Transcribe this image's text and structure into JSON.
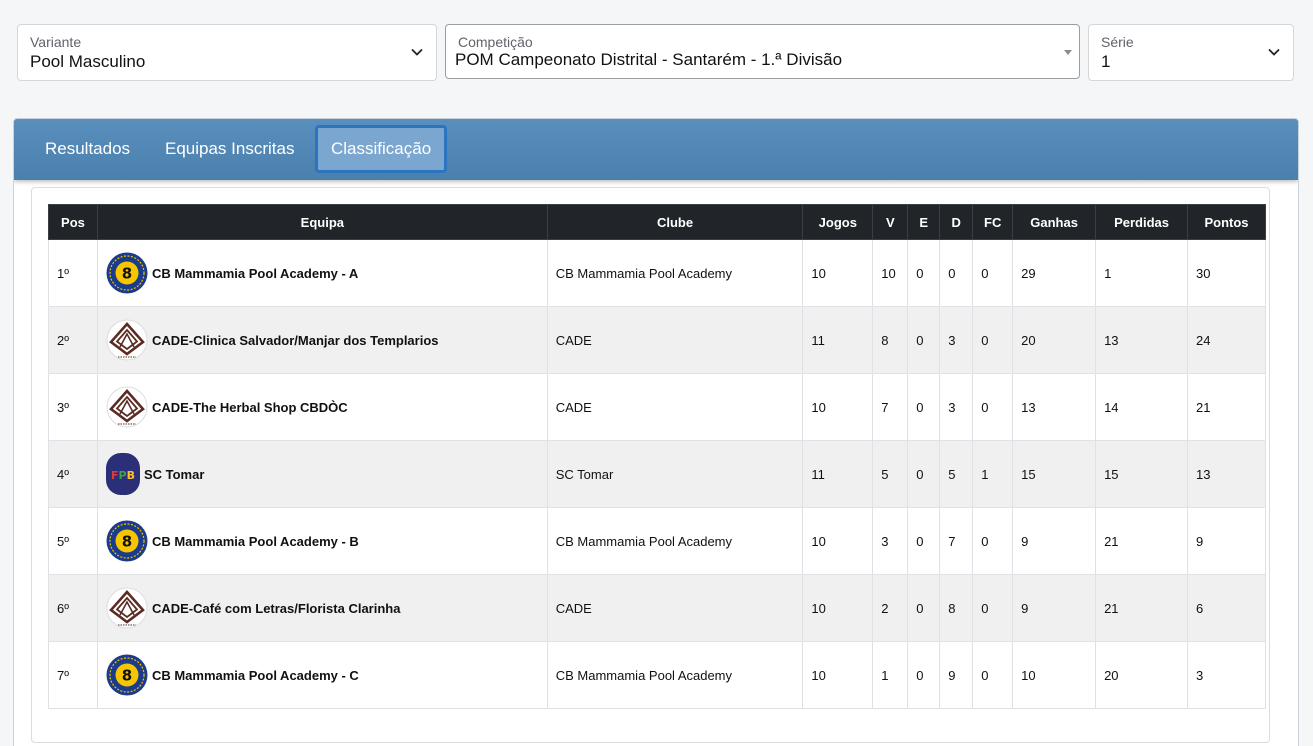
{
  "filters": {
    "variant": {
      "label": "Variante",
      "value": "Pool Masculino"
    },
    "competition": {
      "label": "Competição",
      "value": "POM Campeonato Distrital - Santarém - 1.ª Divisão"
    },
    "serie": {
      "label": "Série",
      "value": "1"
    }
  },
  "tabs": [
    "Resultados",
    "Equipas Inscritas",
    "Classificação"
  ],
  "active_tab": "Classificação",
  "table": {
    "headers": [
      "Pos",
      "Equipa",
      "Clube",
      "Jogos",
      "V",
      "E",
      "D",
      "FC",
      "Ganhas",
      "Perdidas",
      "Pontos"
    ],
    "rows": [
      {
        "pos": "1º",
        "team": "CB Mammamia Pool Academy - A",
        "logo": "mammamia-8-ball-logo",
        "club": "CB Mammamia Pool Academy",
        "jogos": "10",
        "v": "10",
        "e": "0",
        "d": "0",
        "fc": "0",
        "ganhas": "29",
        "perdidas": "1",
        "pontos": "30"
      },
      {
        "pos": "2º",
        "team": "CADE-Clinica Salvador/Manjar dos Templarios",
        "logo": "cade-logo",
        "club": "CADE",
        "jogos": "11",
        "v": "8",
        "e": "0",
        "d": "3",
        "fc": "0",
        "ganhas": "20",
        "perdidas": "13",
        "pontos": "24"
      },
      {
        "pos": "3º",
        "team": "CADE-The Herbal Shop CBDÒC",
        "logo": "cade-logo",
        "club": "CADE",
        "jogos": "10",
        "v": "7",
        "e": "0",
        "d": "3",
        "fc": "0",
        "ganhas": "13",
        "perdidas": "14",
        "pontos": "21"
      },
      {
        "pos": "4º",
        "team": "SC Tomar",
        "logo": "fpb-logo",
        "club": "SC Tomar",
        "jogos": "11",
        "v": "5",
        "e": "0",
        "d": "5",
        "fc": "1",
        "ganhas": "15",
        "perdidas": "15",
        "pontos": "13"
      },
      {
        "pos": "5º",
        "team": "CB Mammamia Pool Academy - B",
        "logo": "mammamia-8-ball-logo",
        "club": "CB Mammamia Pool Academy",
        "jogos": "10",
        "v": "3",
        "e": "0",
        "d": "7",
        "fc": "0",
        "ganhas": "9",
        "perdidas": "21",
        "pontos": "9"
      },
      {
        "pos": "6º",
        "team": "CADE-Café com Letras/Florista Clarinha",
        "logo": "cade-logo",
        "club": "CADE",
        "jogos": "10",
        "v": "2",
        "e": "0",
        "d": "8",
        "fc": "0",
        "ganhas": "9",
        "perdidas": "21",
        "pontos": "6"
      },
      {
        "pos": "7º",
        "team": "CB Mammamia Pool Academy - C",
        "logo": "mammamia-8-ball-logo",
        "club": "CB Mammamia Pool Academy",
        "jogos": "10",
        "v": "1",
        "e": "0",
        "d": "9",
        "fc": "0",
        "ganhas": "10",
        "perdidas": "20",
        "pontos": "3"
      }
    ]
  }
}
